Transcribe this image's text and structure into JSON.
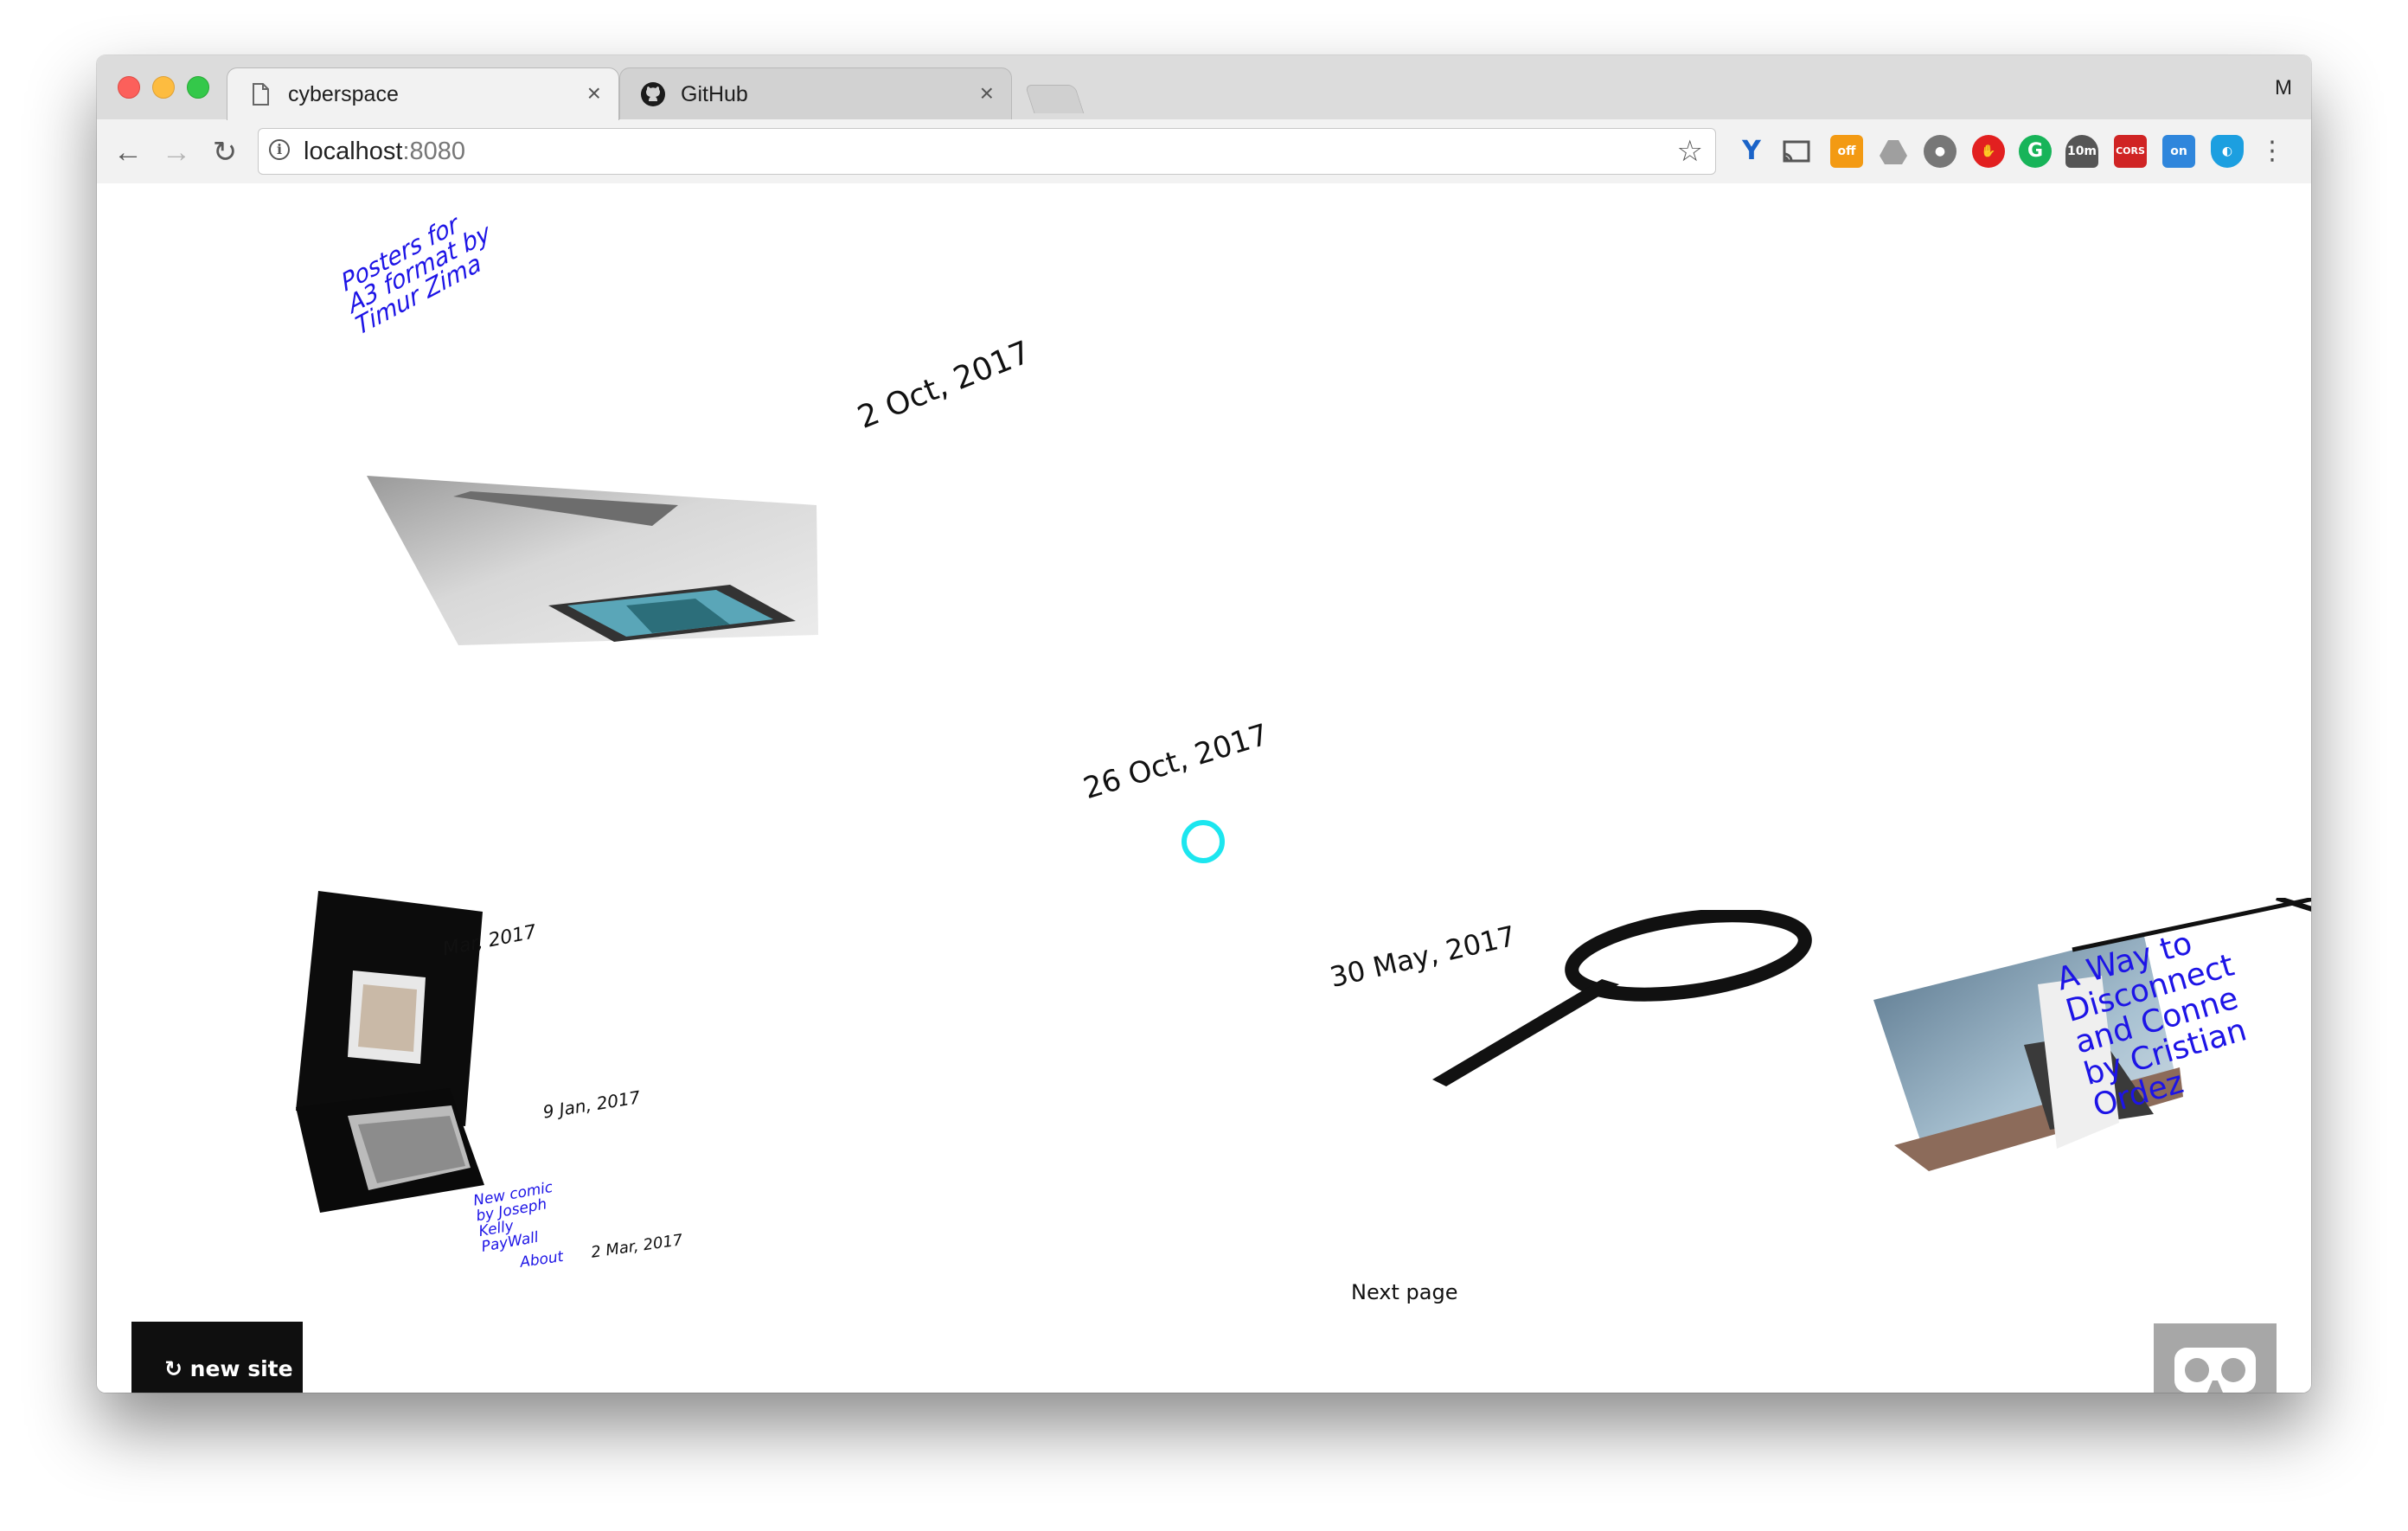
{
  "browser": {
    "tabs": [
      {
        "title": "cyberspace",
        "close": "×"
      },
      {
        "title": "GitHub",
        "close": "×"
      }
    ],
    "profile_initial": "M",
    "address": {
      "host": "localhost",
      "port": ":8080"
    },
    "extensions": [
      {
        "name": "vpn-icon",
        "badge": ""
      },
      {
        "name": "cast-icon",
        "badge": ""
      },
      {
        "name": "off-extension-icon",
        "badge": "off"
      },
      {
        "name": "drive-icon",
        "badge": ""
      },
      {
        "name": "film-icon",
        "badge": ""
      },
      {
        "name": "adblock-icon",
        "badge": ""
      },
      {
        "name": "grammarly-icon",
        "badge": ""
      },
      {
        "name": "timer-icon",
        "badge": "10m"
      },
      {
        "name": "cors-icon",
        "badge": "CORS"
      },
      {
        "name": "on-extension-icon",
        "badge": "on"
      },
      {
        "name": "mask-icon",
        "badge": ""
      }
    ]
  },
  "page": {
    "items": [
      {
        "kind": "link",
        "text_lines": [
          "Posters for",
          "A3 format by",
          "Timur Zima"
        ]
      },
      {
        "kind": "date",
        "text": "2 Oct, 2017"
      },
      {
        "kind": "date",
        "text": "26 Oct, 2017"
      },
      {
        "kind": "date",
        "text": "30 May, 2017"
      },
      {
        "kind": "date",
        "text": "Mar, 2017"
      },
      {
        "kind": "date",
        "text": "9 Jan, 2017"
      },
      {
        "kind": "link",
        "text_lines": [
          "New comic",
          "by Joseph",
          "Kelly",
          "PayWall"
        ]
      },
      {
        "kind": "link",
        "text": "About"
      },
      {
        "kind": "date",
        "text": "2 Mar, 2017"
      },
      {
        "kind": "link",
        "text_lines": [
          "A Way to",
          "Disconnect",
          "and Conne",
          "by Cristian",
          "Ordez"
        ]
      }
    ],
    "next_page": "Next page",
    "new_site_label": "↻ new site",
    "vr_button_icon": "vr-goggles-icon",
    "accent_colors": {
      "link_blue": "#1d14e6",
      "cursor_cyan": "#1ce6ef"
    }
  }
}
